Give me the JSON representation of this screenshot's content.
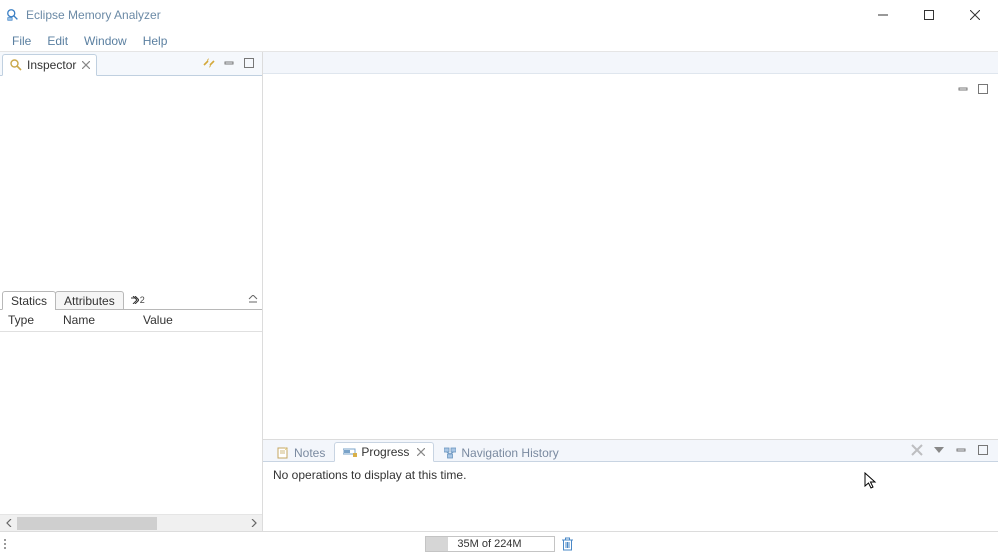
{
  "window": {
    "title": "Eclipse Memory Analyzer"
  },
  "menu": {
    "items": [
      "File",
      "Edit",
      "Window",
      "Help"
    ]
  },
  "left_view": {
    "tab_label": "Inspector",
    "mid_tabs": {
      "statics": "Statics",
      "attributes": "Attributes",
      "overflow": "2"
    },
    "columns": {
      "type": "Type",
      "name": "Name",
      "value": "Value"
    }
  },
  "bottom": {
    "tabs": {
      "notes": "Notes",
      "progress": "Progress",
      "nav": "Navigation History"
    },
    "progress_message": "No operations to display at this time."
  },
  "status": {
    "heap": "35M of 224M"
  }
}
